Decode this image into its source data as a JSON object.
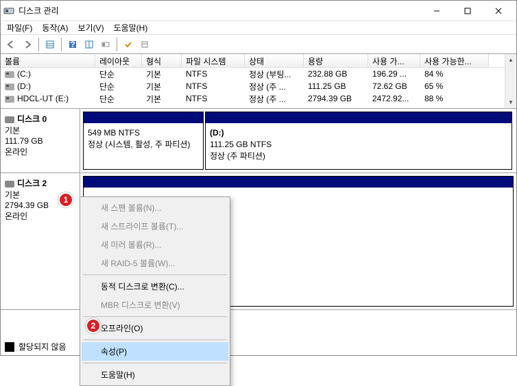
{
  "window": {
    "title": "디스크 관리",
    "min": "—",
    "max": "☐",
    "close": "✕"
  },
  "menu": {
    "file": "파일(F)",
    "action": "동작(A)",
    "view": "보기(V)",
    "help": "도움말(H)"
  },
  "columns": {
    "volume": "볼륨",
    "layout": "레이아웃",
    "type": "형식",
    "fs": "파일 시스템",
    "status": "상태",
    "capacity": "용량",
    "free": "사용 가...",
    "freepct": "사용 가능한..."
  },
  "volumes": [
    {
      "name": "(C:)",
      "layout": "단순",
      "type": "기본",
      "fs": "NTFS",
      "status": "정상 (부팅...",
      "capacity": "232.88 GB",
      "free": "196.29 ...",
      "freepct": "84 %"
    },
    {
      "name": "(D:)",
      "layout": "단순",
      "type": "기본",
      "fs": "NTFS",
      "status": "정상 (주 ...",
      "capacity": "111.25 GB",
      "free": "72.62 GB",
      "freepct": "65 %"
    },
    {
      "name": "HDCL-UT (E:)",
      "layout": "단순",
      "type": "기본",
      "fs": "NTFS",
      "status": "정상 (주 ...",
      "capacity": "2794.39 GB",
      "free": "2472.92...",
      "freepct": "88 %"
    }
  ],
  "disk0": {
    "name": "디스크 0",
    "type": "기본",
    "size": "111.79 GB",
    "state": "온라인",
    "part1": {
      "size": "549 MB NTFS",
      "status": "정상 (시스템, 활성, 주 파티션)"
    },
    "part2": {
      "name": "(D:)",
      "size": "111.25 GB NTFS",
      "status": "정상 (주 파티션)"
    }
  },
  "disk2": {
    "name": "디스크 2",
    "type": "기본",
    "size": "2794.39 GB",
    "state": "온라인"
  },
  "legend": {
    "unallocated": "할당되지 않음"
  },
  "context_menu": {
    "span": "새 스팬 볼륨(N)...",
    "stripe": "새 스트라이프 볼륨(T)...",
    "mirror": "새 미러 볼륨(R)...",
    "raid5": "새 RAID-5 볼륨(W)...",
    "to_dynamic": "동적 디스크로 변환(C)...",
    "to_mbr": "MBR 디스크로 변환(V)",
    "offline": "오프라인(O)",
    "properties": "속성(P)",
    "help": "도움말(H)"
  },
  "badges": {
    "b1": "1",
    "b2": "2"
  }
}
